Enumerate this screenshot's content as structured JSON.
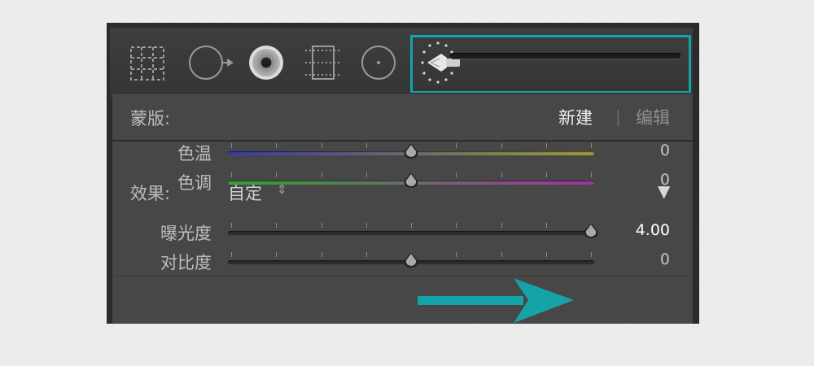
{
  "toolbar": {
    "tools": [
      {
        "name": "crop-overlay-icon"
      },
      {
        "name": "spot-removal-icon"
      },
      {
        "name": "red-eye-icon"
      },
      {
        "name": "graduated-filter-icon"
      },
      {
        "name": "radial-filter-icon"
      },
      {
        "name": "adjustment-brush-icon"
      }
    ],
    "highlight_color": "#14a3a8"
  },
  "mask": {
    "label": "蒙版:",
    "new_label": "新建",
    "divider": "|",
    "edit_label": "编辑"
  },
  "effect": {
    "label": "效果:",
    "preset_value": "自定",
    "preset_arrows": "⇕",
    "collapse_icon": "▼"
  },
  "sliders": [
    {
      "label": "色温",
      "value_text": "0",
      "value": 0,
      "min": -100,
      "max": 100,
      "gradient": [
        "#3a3aa6",
        "#9c9c33"
      ]
    },
    {
      "label": "色调",
      "value_text": "0",
      "value": 0,
      "min": -100,
      "max": 100,
      "gradient": [
        "#33a433",
        "#a233a2"
      ]
    },
    {
      "label": "曝光度",
      "value_text": "4.00",
      "value": 4.0,
      "min": -4,
      "max": 4,
      "gradient": [
        "#2c2c2c",
        "#2c2c2c"
      ]
    },
    {
      "label": "对比度",
      "value_text": "0",
      "value": 0,
      "min": -100,
      "max": 100,
      "gradient": [
        "#2c2c2c",
        "#2c2c2c"
      ]
    }
  ],
  "annotation_color": "#14a3a8"
}
